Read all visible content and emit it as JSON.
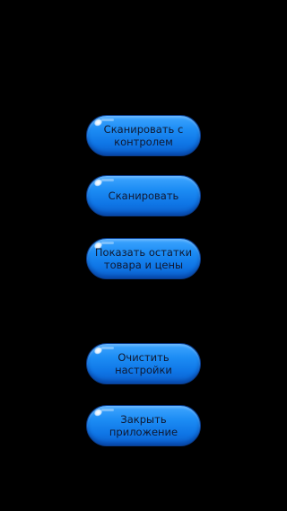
{
  "buttons": {
    "scan_with_control": "Сканировать с контролем",
    "scan": "Сканировать",
    "show_stock": "Показать остатки товара и цены",
    "clear_settings": "Очистить настройки",
    "close_app": "Закрыть приложение"
  },
  "colors": {
    "background": "#000000",
    "button_fill": "#1c8cf4",
    "button_text": "#101830"
  }
}
